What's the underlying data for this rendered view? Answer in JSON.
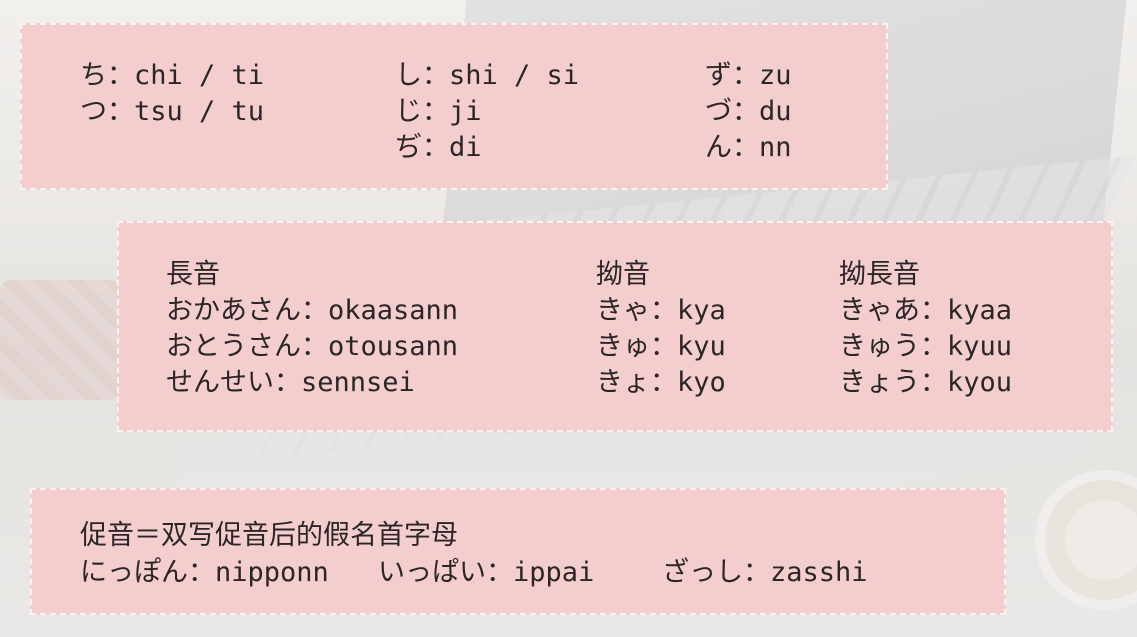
{
  "romaji_card": {
    "col1": [
      "ち：chi / ti",
      "つ：tsu / tu"
    ],
    "col2": [
      "し：shi / si",
      "じ：ji",
      "ぢ：di"
    ],
    "col3": [
      "ず：zu",
      "づ：du",
      "ん：nn"
    ]
  },
  "long_vowel_card": {
    "long_vowel": {
      "heading": "長音",
      "items": [
        "おかあさん：okaasann",
        "おとうさん：otousann",
        "せんせい：sennsei"
      ]
    },
    "youon": {
      "heading": "拗音",
      "items": [
        "きゃ：kya",
        "きゅ：kyu",
        "きょ：kyo"
      ]
    },
    "youon_long": {
      "heading": "拗長音",
      "items": [
        "きゃあ：kyaa",
        "きゅう：kyuu",
        "きょう：kyou"
      ]
    }
  },
  "sokuon_card": {
    "rule": "促音＝双写促音后的假名首字母",
    "examples": [
      "にっぽん：nipponn",
      "いっぱい：ippai",
      "ざっし：zasshi"
    ]
  }
}
